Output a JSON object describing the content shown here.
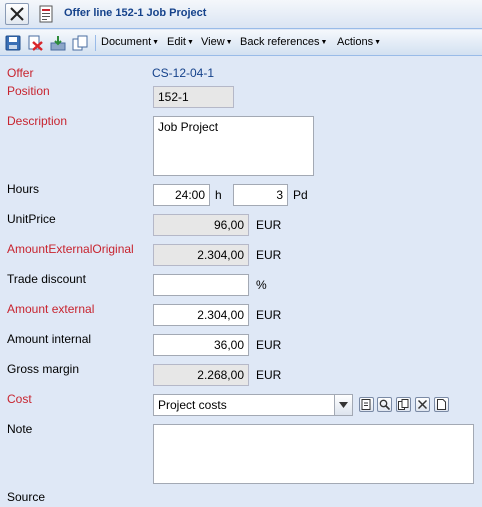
{
  "window": {
    "title": "Offer line 152-1 Job Project"
  },
  "toolbar": {
    "icons": [
      "save-icon",
      "delete-icon",
      "export-icon",
      "copy-icon"
    ],
    "menus": [
      "Document",
      "Edit",
      "View",
      "Back references",
      "Actions"
    ]
  },
  "form": {
    "offer": {
      "label": "Offer",
      "value": "CS-12-04-1"
    },
    "position": {
      "label": "Position",
      "value": "152-1"
    },
    "description": {
      "label": "Description",
      "value": "Job Project"
    },
    "hours": {
      "label": "Hours",
      "value": "24:00",
      "unit": "h",
      "pd_value": "3",
      "pd_unit": "Pd"
    },
    "unit_price": {
      "label": "UnitPrice",
      "value": "96,00",
      "unit": "EUR"
    },
    "amount_external_original": {
      "label": "AmountExternalOriginal",
      "value": "2.304,00",
      "unit": "EUR"
    },
    "trade_discount": {
      "label": "Trade discount",
      "value": "",
      "unit": "%"
    },
    "amount_external": {
      "label": "Amount external",
      "value": "2.304,00",
      "unit": "EUR"
    },
    "amount_internal": {
      "label": "Amount internal",
      "value": "36,00",
      "unit": "EUR"
    },
    "gross_margin": {
      "label": "Gross margin",
      "value": "2.268,00",
      "unit": "EUR"
    },
    "cost": {
      "label": "Cost",
      "value": "Project costs"
    },
    "note": {
      "label": "Note",
      "value": ""
    },
    "source": {
      "label": "Source"
    }
  },
  "colors": {
    "required_label": "#c8242f",
    "link": "#15428b",
    "background": "#dfe8f6"
  }
}
